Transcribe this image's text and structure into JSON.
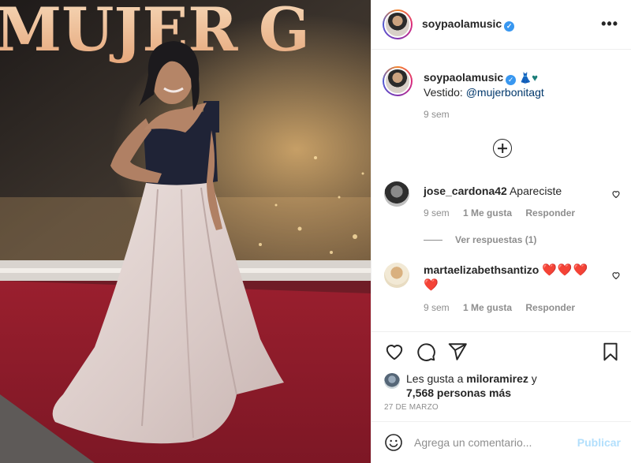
{
  "header": {
    "username": "soypaolamusic",
    "verified_icon": "verified-badge-icon",
    "more_icon": "more-options-icon"
  },
  "photo": {
    "backdrop_text": "MUJER G"
  },
  "caption": {
    "username": "soypaolamusic",
    "emoji": "👗♥",
    "text_prefix": "Vestido: ",
    "mention": "@mujerbonitagt",
    "time": "9 sem"
  },
  "comments": [
    {
      "username": "jose_cardona42",
      "text": "Apareciste",
      "time": "9 sem",
      "likes": "1 Me gusta",
      "reply_label": "Responder",
      "replies_label": "Ver respuestas (1)"
    },
    {
      "username": "martaelizabethsantizo",
      "text": "❤️❤️❤️❤️",
      "time": "9 sem",
      "likes": "1 Me gusta",
      "reply_label": "Responder"
    }
  ],
  "likes": {
    "prefix": "Les gusta a ",
    "user": "miloramirez",
    "connector": " y",
    "others": "7,568 personas más"
  },
  "date": "27 DE MARZO",
  "add_comment": {
    "placeholder": "Agrega un comentario...",
    "publish_label": "Publicar"
  },
  "colors": {
    "link": "#00376b",
    "verified": "#3897f0",
    "muted": "#8e8e8e",
    "publish_disabled": "#b2dffc",
    "heart": "#e0242d"
  }
}
